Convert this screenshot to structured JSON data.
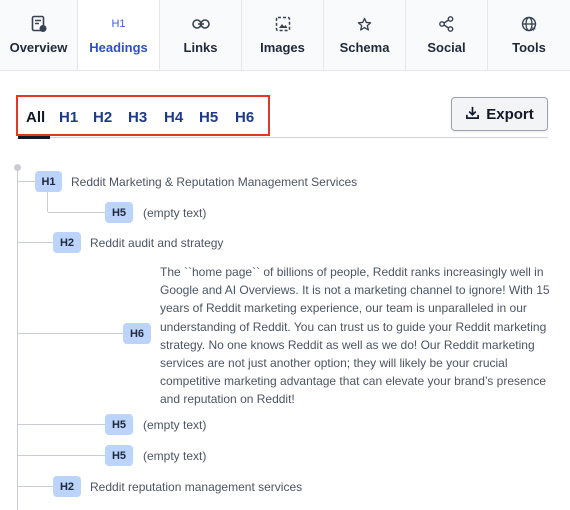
{
  "tabs": [
    {
      "label": "Overview",
      "icon": "document-chart-icon"
    },
    {
      "label": "Headings",
      "icon": "h1-icon",
      "icon_text": "H1",
      "active": true
    },
    {
      "label": "Links",
      "icon": "link-icon"
    },
    {
      "label": "Images",
      "icon": "image-icon"
    },
    {
      "label": "Schema",
      "icon": "star-icon"
    },
    {
      "label": "Social",
      "icon": "share-icon"
    },
    {
      "label": "Tools",
      "icon": "globe-icon"
    }
  ],
  "filters": [
    "All",
    "H1",
    "H2",
    "H3",
    "H4",
    "H5",
    "H6"
  ],
  "export_label": "Export",
  "headings": [
    {
      "level": "H1",
      "text": "Reddit Marketing & Reputation Management Services"
    },
    {
      "level": "H5",
      "text": "(empty text)"
    },
    {
      "level": "H2",
      "text": "Reddit audit and strategy"
    },
    {
      "level": "H6",
      "text": "The ``home page`` of billions of people, Reddit ranks increasingly well in Google and AI Overviews. It is not a marketing channel to ignore! With 15 years of Reddit marketing experience, our team is unparalleled in our understanding of Reddit. You can trust us to guide your Reddit marketing strategy. No one knows Reddit as well as we do! Our Reddit marketing services are not just another option; they will likely be your crucial competitive marketing advantage that can elevate your brand’s presence and reputation on Reddit!"
    },
    {
      "level": "H5",
      "text": "(empty text)"
    },
    {
      "level": "H5",
      "text": "(empty text)"
    },
    {
      "level": "H2",
      "text": "Reddit reputation management services"
    }
  ],
  "colors": {
    "accent": "#2f4fc2",
    "badge": "#bcd3fb",
    "highlight_box": "#e0362c"
  }
}
